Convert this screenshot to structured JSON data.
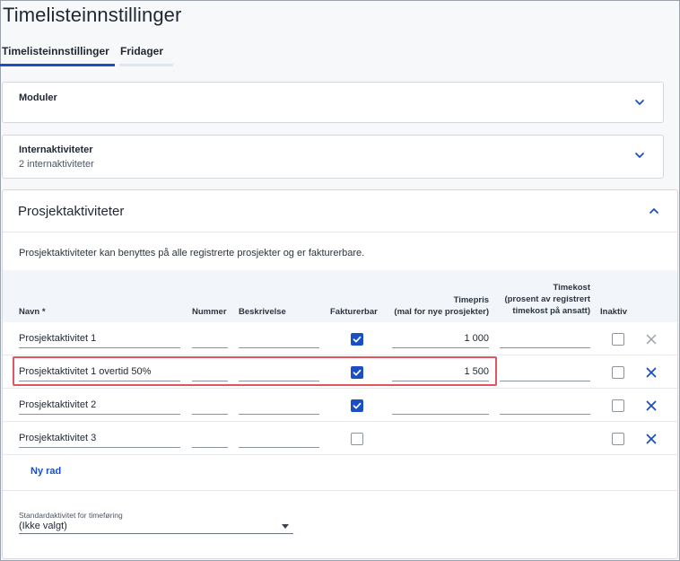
{
  "page": {
    "title": "Timelisteinnstillinger"
  },
  "tabs": [
    {
      "label": "Timelisteinnstillinger",
      "active": true
    },
    {
      "label": "Fridager",
      "active": false
    }
  ],
  "moduler": {
    "title": "Moduler"
  },
  "internaktiviteter": {
    "title": "Internaktiviteter",
    "subtitle": "2 internaktiviteter"
  },
  "prosjekt": {
    "title": "Prosjektaktiviteter",
    "description": "Prosjektaktiviteter kan benyttes på alle registrerte prosjekter og er fakturerbare.",
    "columns": {
      "navn": "Navn *",
      "nummer": "Nummer",
      "beskrivelse": "Beskrivelse",
      "fakturerbar": "Fakturerbar",
      "timepris_1": "Timepris",
      "timepris_2": "(mal for nye prosjekter)",
      "timekost_1": "Timekost",
      "timekost_2": "(prosent av registrert",
      "timekost_3": "timekost på ansatt)",
      "inaktiv": "Inaktiv"
    },
    "rows": [
      {
        "navn": "Prosjektaktivitet 1",
        "nummer": "",
        "beskrivelse": "",
        "fakturerbar": true,
        "timepris": "1 000",
        "timekost": "",
        "inaktiv": false,
        "delete_enabled": false
      },
      {
        "navn": "Prosjektaktivitet 1 overtid 50%",
        "nummer": "",
        "beskrivelse": "",
        "fakturerbar": true,
        "timepris": "1 500",
        "timekost": "",
        "inaktiv": false,
        "delete_enabled": true
      },
      {
        "navn": "Prosjektaktivitet 2",
        "nummer": "",
        "beskrivelse": "",
        "fakturerbar": true,
        "timepris": "",
        "timekost": "",
        "inaktiv": false,
        "delete_enabled": true
      },
      {
        "navn": "Prosjektaktivitet 3",
        "nummer": "",
        "beskrivelse": "",
        "fakturerbar": false,
        "timepris": "",
        "timekost": "",
        "inaktiv": false,
        "delete_enabled": true
      }
    ],
    "add_row_label": "Ny rad",
    "standard": {
      "label": "Standardaktivitet for timeføring",
      "value": "(Ikke valgt)"
    }
  },
  "colors": {
    "accent": "#1a4fc4",
    "highlight": "#e0555f",
    "x_disabled": "#9aa3ad"
  }
}
